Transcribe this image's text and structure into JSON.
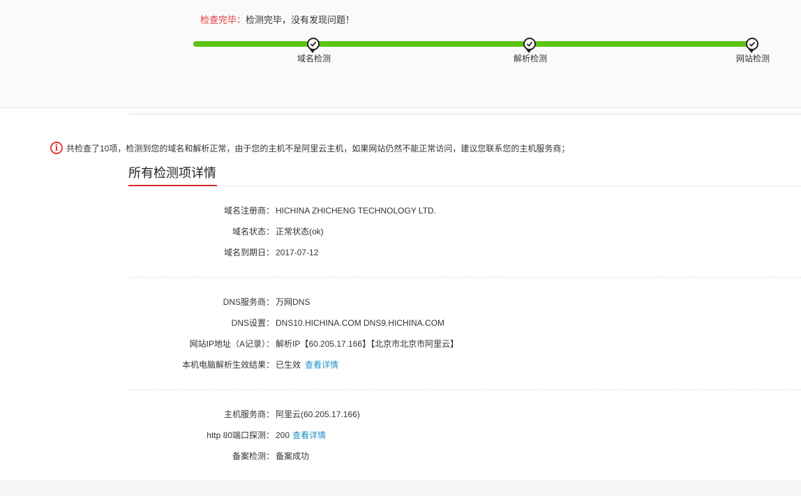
{
  "status": {
    "label": "检查完毕：",
    "message": "检测完毕，没有发现问题！"
  },
  "progress": {
    "steps": [
      {
        "label": "域名检测",
        "done": true
      },
      {
        "label": "解析检测",
        "done": true
      },
      {
        "label": "网站检测",
        "done": true
      }
    ],
    "color": "#5cc414"
  },
  "summary": {
    "icon": "info-icon",
    "text": "共检查了10项，检测到您的域名和解析正常，由于您的主机不是阿里云主机，如果网站仍然不能正常访问，建议您联系您的主机服务商；"
  },
  "section": {
    "title": "所有检测项详情"
  },
  "domain_group": [
    {
      "key": "域名注册商：",
      "value": "HICHINA ZHICHENG TECHNOLOGY LTD."
    },
    {
      "key": "域名状态：",
      "value": "正常状态(ok)"
    },
    {
      "key": "域名到期日：",
      "value": "2017-07-12"
    }
  ],
  "dns_group": [
    {
      "key": "DNS服务商：",
      "value": "万网DNS"
    },
    {
      "key": "DNS设置：",
      "value": "DNS10.HICHINA.COM DNS9.HICHINA.COM"
    },
    {
      "key": "网站IP地址（A记录）：",
      "value": "解析IP【60.205.17.166】【北京市北京市阿里云】"
    },
    {
      "key": "本机电脑解析生效结果：",
      "value": "已生效",
      "link": "查看详情"
    }
  ],
  "host_group": [
    {
      "key": "主机服务商：",
      "value": "阿里云(60.205.17.166)"
    },
    {
      "key": "http 80端口探测：",
      "value": "200",
      "link": "查看详情"
    },
    {
      "key": "备案检测：",
      "value": "备案成功"
    }
  ],
  "colors": {
    "accent_red": "#e4393c",
    "link_blue": "#1e8fc6",
    "progress_green": "#5cc414"
  }
}
